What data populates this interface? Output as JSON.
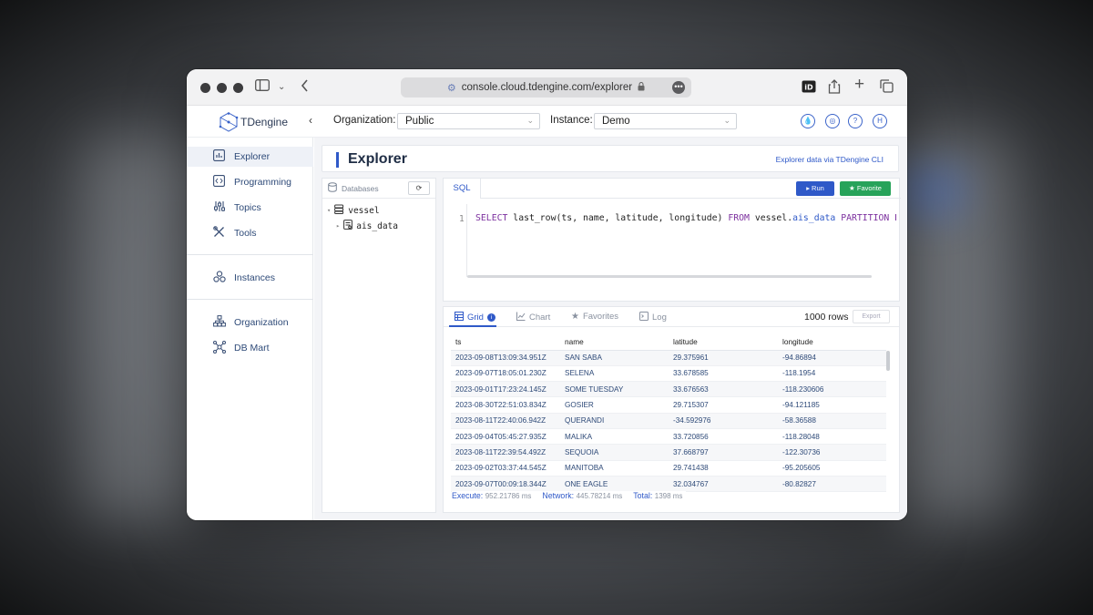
{
  "browser": {
    "url": "console.cloud.tdengine.com/explorer",
    "more_icon": "ellipsis-icon"
  },
  "header": {
    "logo_text": "TDengine",
    "organization_label": "Organization:",
    "organization_value": "Public",
    "instance_label": "Instance:",
    "instance_value": "Demo",
    "icons": [
      "drop-icon",
      "wallet-icon",
      "help-icon",
      "avatar-icon"
    ],
    "help_glyph": "?",
    "avatar_initial": "H"
  },
  "sidebar": {
    "items": [
      {
        "label": "Explorer",
        "icon": "chart-icon"
      },
      {
        "label": "Programming",
        "icon": "code-icon"
      },
      {
        "label": "Topics",
        "icon": "topics-icon"
      },
      {
        "label": "Tools",
        "icon": "tools-icon"
      },
      {
        "label": "Instances",
        "icon": "instances-icon"
      },
      {
        "label": "Organization",
        "icon": "organization-icon"
      },
      {
        "label": "DB Mart",
        "icon": "dbmart-icon"
      }
    ]
  },
  "page": {
    "title": "Explorer",
    "cli_link": "Explorer data via TDengine CLI"
  },
  "databases": {
    "header": "Databases",
    "db_name": "vessel",
    "table_name": "ais_data"
  },
  "sql": {
    "tab_label": "SQL",
    "run_label": "Run",
    "favorite_label": "Favorite",
    "line_number": "1",
    "query": "SELECT last_row(ts, name, latitude, longitude) FROM vessel.ais_data PARTITION BY n"
  },
  "grid": {
    "tabs": [
      "Grid",
      "Chart",
      "Favorites",
      "Log"
    ],
    "row_count": "1000 rows",
    "export_label": "Export",
    "columns": [
      "ts",
      "name",
      "latitude",
      "longitude"
    ],
    "rows": [
      [
        "2023-09-08T13:09:34.951Z",
        "SAN SABA",
        "29.375961",
        "-94.86894"
      ],
      [
        "2023-09-07T18:05:01.230Z",
        "SELENA",
        "33.678585",
        "-118.1954"
      ],
      [
        "2023-09-01T17:23:24.145Z",
        "SOME TUESDAY",
        "33.676563",
        "-118.230606"
      ],
      [
        "2023-08-30T22:51:03.834Z",
        "GOSIER",
        "29.715307",
        "-94.121185"
      ],
      [
        "2023-08-11T22:40:06.942Z",
        "QUERANDI",
        "-34.592976",
        "-58.36588"
      ],
      [
        "2023-09-04T05:45:27.935Z",
        "MALIKA",
        "33.720856",
        "-118.28048"
      ],
      [
        "2023-08-11T22:39:54.492Z",
        "SEQUOIA",
        "37.668797",
        "-122.30736"
      ],
      [
        "2023-09-02T03:37:44.545Z",
        "MANITOBA",
        "29.741438",
        "-95.205605"
      ],
      [
        "2023-09-07T00:09:18.344Z",
        "ONE EAGLE",
        "32.034767",
        "-80.82827"
      ]
    ],
    "stats": {
      "execute_label": "Execute:",
      "execute_value": "952.21786 ms",
      "network_label": "Network:",
      "network_value": "445.78214 ms",
      "total_label": "Total:",
      "total_value": "1398 ms"
    }
  },
  "colors": {
    "accent": "#2f59c8",
    "favorite": "#27a35a"
  }
}
